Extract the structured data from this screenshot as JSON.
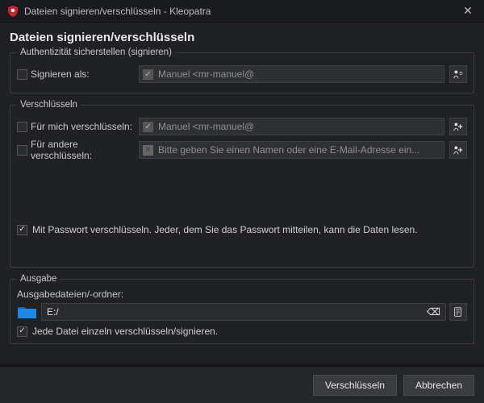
{
  "window": {
    "title": "Dateien signieren/verschlüsseln - Kleopatra"
  },
  "header": "Dateien signieren/verschlüsseln",
  "sign": {
    "legend": "Authentizität sicherstellen (signieren)",
    "as_label": "Signieren als:",
    "identity": "Manuel <mr-manuel@"
  },
  "encrypt": {
    "legend": "Verschlüsseln",
    "for_me_label": "Für mich verschlüsseln:",
    "for_me_identity": "Manuel <mr-manuel@",
    "for_others_label": "Für andere verschlüsseln:",
    "others_placeholder": "Bitte geben Sie einen Namen oder eine E-Mail-Adresse ein...",
    "password_label": "Mit Passwort verschlüsseln. Jeder, dem Sie das Passwort mitteilen, kann die Daten lesen."
  },
  "output": {
    "legend": "Ausgabe",
    "label": "Ausgabedateien/-ordner:",
    "path": "E:/",
    "each_file_label": "Jede Datei einzeln verschlüsseln/signieren."
  },
  "footer": {
    "encrypt_btn": "Verschlüsseln",
    "cancel_btn": "Abbrechen"
  }
}
